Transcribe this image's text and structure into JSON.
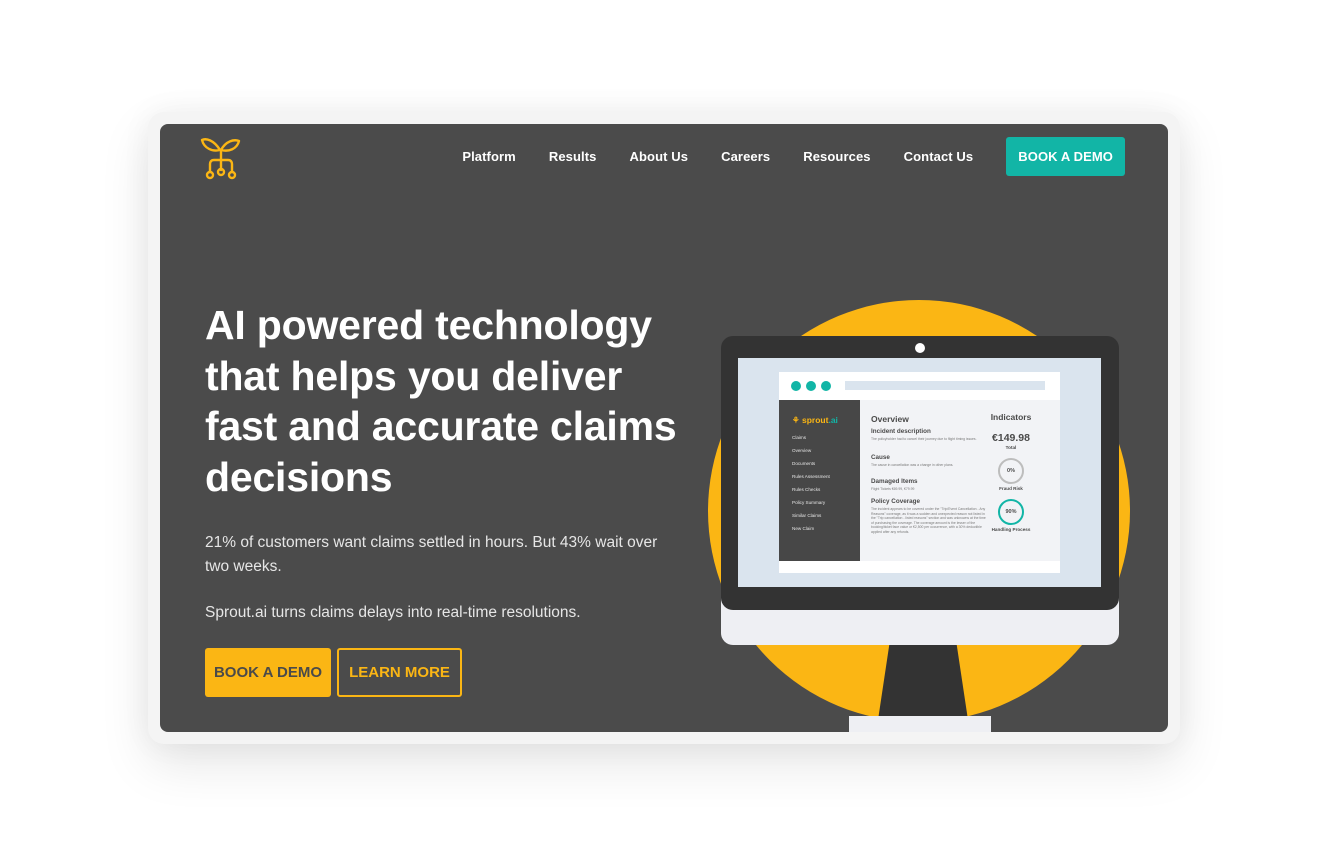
{
  "brand": {
    "logo_icon": "sprout-circuit-icon",
    "accent": "#fbb614",
    "teal": "#12b5a6",
    "background": "#4b4b4b"
  },
  "nav": {
    "items": [
      {
        "label": "Platform"
      },
      {
        "label": "Results"
      },
      {
        "label": "About Us"
      },
      {
        "label": "Careers"
      },
      {
        "label": "Resources"
      },
      {
        "label": "Contact Us"
      }
    ],
    "cta_label": "BOOK A DEMO"
  },
  "hero": {
    "headline": "AI powered technology that helps you deliver fast and accurate claims decisions",
    "paragraph_1": "21% of customers want claims settled in hours. But 43% wait over two weeks.",
    "paragraph_2": "Sprout.ai turns claims delays into real-time resolutions.",
    "primary_button": "BOOK A DEMO",
    "secondary_button": "LEARN MORE"
  },
  "illustration": {
    "app_brand": "sprout",
    "app_brand_suffix": ".ai",
    "sidebar_items": [
      "Claims",
      "Overview",
      "Documents",
      "Rules Assessment",
      "Rules Checks",
      "Policy Summary",
      "Similar Claims",
      "New Claim"
    ],
    "overview_title": "Overview",
    "sections": [
      {
        "title": "Incident description",
        "text": "The policyholder had to cancel their journey due to flight timing issues."
      },
      {
        "title": "Cause",
        "text": "The cause in cancellation was a change in other plans."
      },
      {
        "title": "Damaged Items",
        "text": "Flight Tickets €69.99, €79.99"
      },
      {
        "title": "Policy Coverage",
        "text": "The incident appears to be covered under the \"Trip/Event Cancellation - Any Reasons\" coverage, as it was a sudden and unexpected reason not listed in the \"Trip cancellation - listed reasons\" section and was unknowns at the time of purchasing the coverage. The coverage amount is the lesser of the booking/ticket face value or €2,500 per occurrence, with a 30% deductible applied after any refunds."
      }
    ],
    "indicators": {
      "title": "Indicators",
      "total_value": "€149.98",
      "total_label": "Total",
      "fraud_risk_value": "0%",
      "fraud_risk_label": "Fraud Risk",
      "handling_value": "90%",
      "handling_label": "Handling Process"
    }
  }
}
